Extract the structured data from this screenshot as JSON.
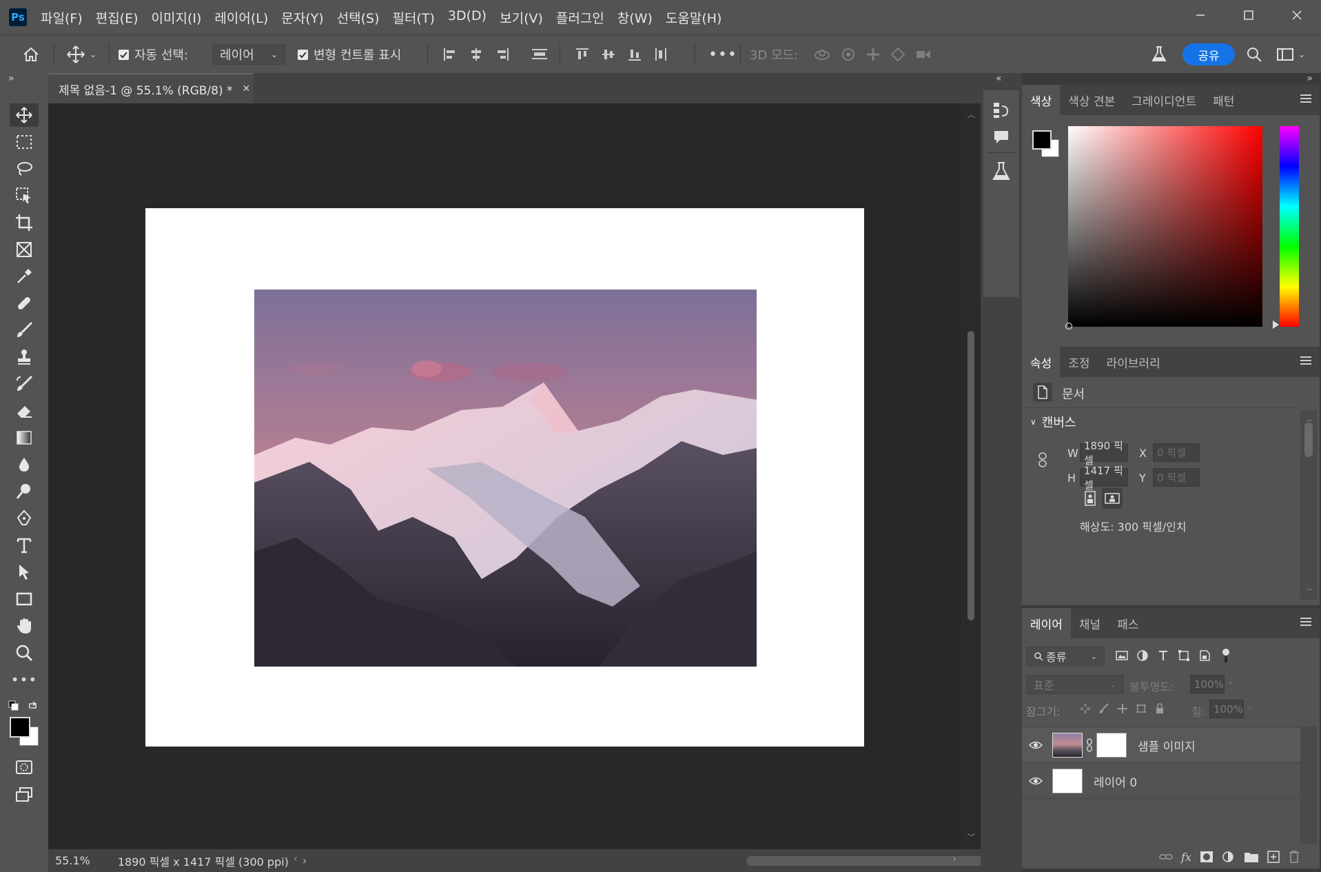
{
  "app": {
    "logo": "Ps"
  },
  "menu": [
    "파일(F)",
    "편집(E)",
    "이미지(I)",
    "레이어(L)",
    "문자(Y)",
    "선택(S)",
    "필터(T)",
    "3D(D)",
    "보기(V)",
    "플러그인",
    "창(W)",
    "도움말(H)"
  ],
  "options": {
    "auto_select_label": "자동 선택:",
    "auto_select_value": "레이어",
    "show_transform_label": "변형 컨트롤 표시",
    "mode_3d_label": "3D 모드:",
    "share_label": "공유"
  },
  "document": {
    "tab_title": "제목 없음-1 @ 55.1% (RGB/8) *",
    "zoom": "55.1%",
    "info": "1890 픽셀 x 1417 픽셀 (300 ppi)"
  },
  "color_panel": {
    "tabs": [
      "색상",
      "색상 견본",
      "그레이디언트",
      "패턴"
    ],
    "foreground": "#000000",
    "background": "#ffffff",
    "hue_color": "#ff0000"
  },
  "properties_panel": {
    "tabs": [
      "속성",
      "조정",
      "라이브러리"
    ],
    "doc_label": "문서",
    "canvas_header": "캔버스",
    "w_label": "W",
    "h_label": "H",
    "x_label": "X",
    "y_label": "Y",
    "width": "1890 픽셀",
    "height": "1417 픽셀",
    "x_placeholder": "0 픽셀",
    "y_placeholder": "0 픽셀",
    "resolution": "해상도: 300 픽셀/인치"
  },
  "layers_panel": {
    "tabs": [
      "레이어",
      "채널",
      "패스"
    ],
    "filter_kind": "종류",
    "blend_mode": "표준",
    "opacity_label": "불투명도:",
    "opacity_value": "100%",
    "lock_label": "잠그기:",
    "fill_label": "칠:",
    "fill_value": "100%",
    "layers": [
      {
        "name": "샘플 이미지"
      },
      {
        "name": "레이어 0"
      }
    ]
  }
}
